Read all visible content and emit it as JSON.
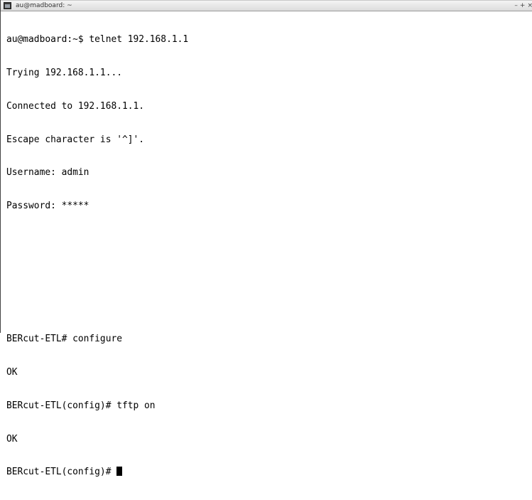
{
  "window": {
    "title": "au@madboard: ~",
    "buttons": [
      "–",
      "+",
      "×"
    ]
  },
  "terminal": {
    "lines": [
      "au@madboard:~$ telnet 192.168.1.1",
      "Trying 192.168.1.1...",
      "Connected to 192.168.1.1.",
      "Escape character is '^]'.",
      "Username: admin",
      "Password: *****",
      "",
      "",
      "",
      "BERcut-ETL# configure",
      "OK",
      "BERcut-ETL(config)# tftp on",
      "OK"
    ],
    "prompt": "BERcut-ETL(config)# "
  }
}
